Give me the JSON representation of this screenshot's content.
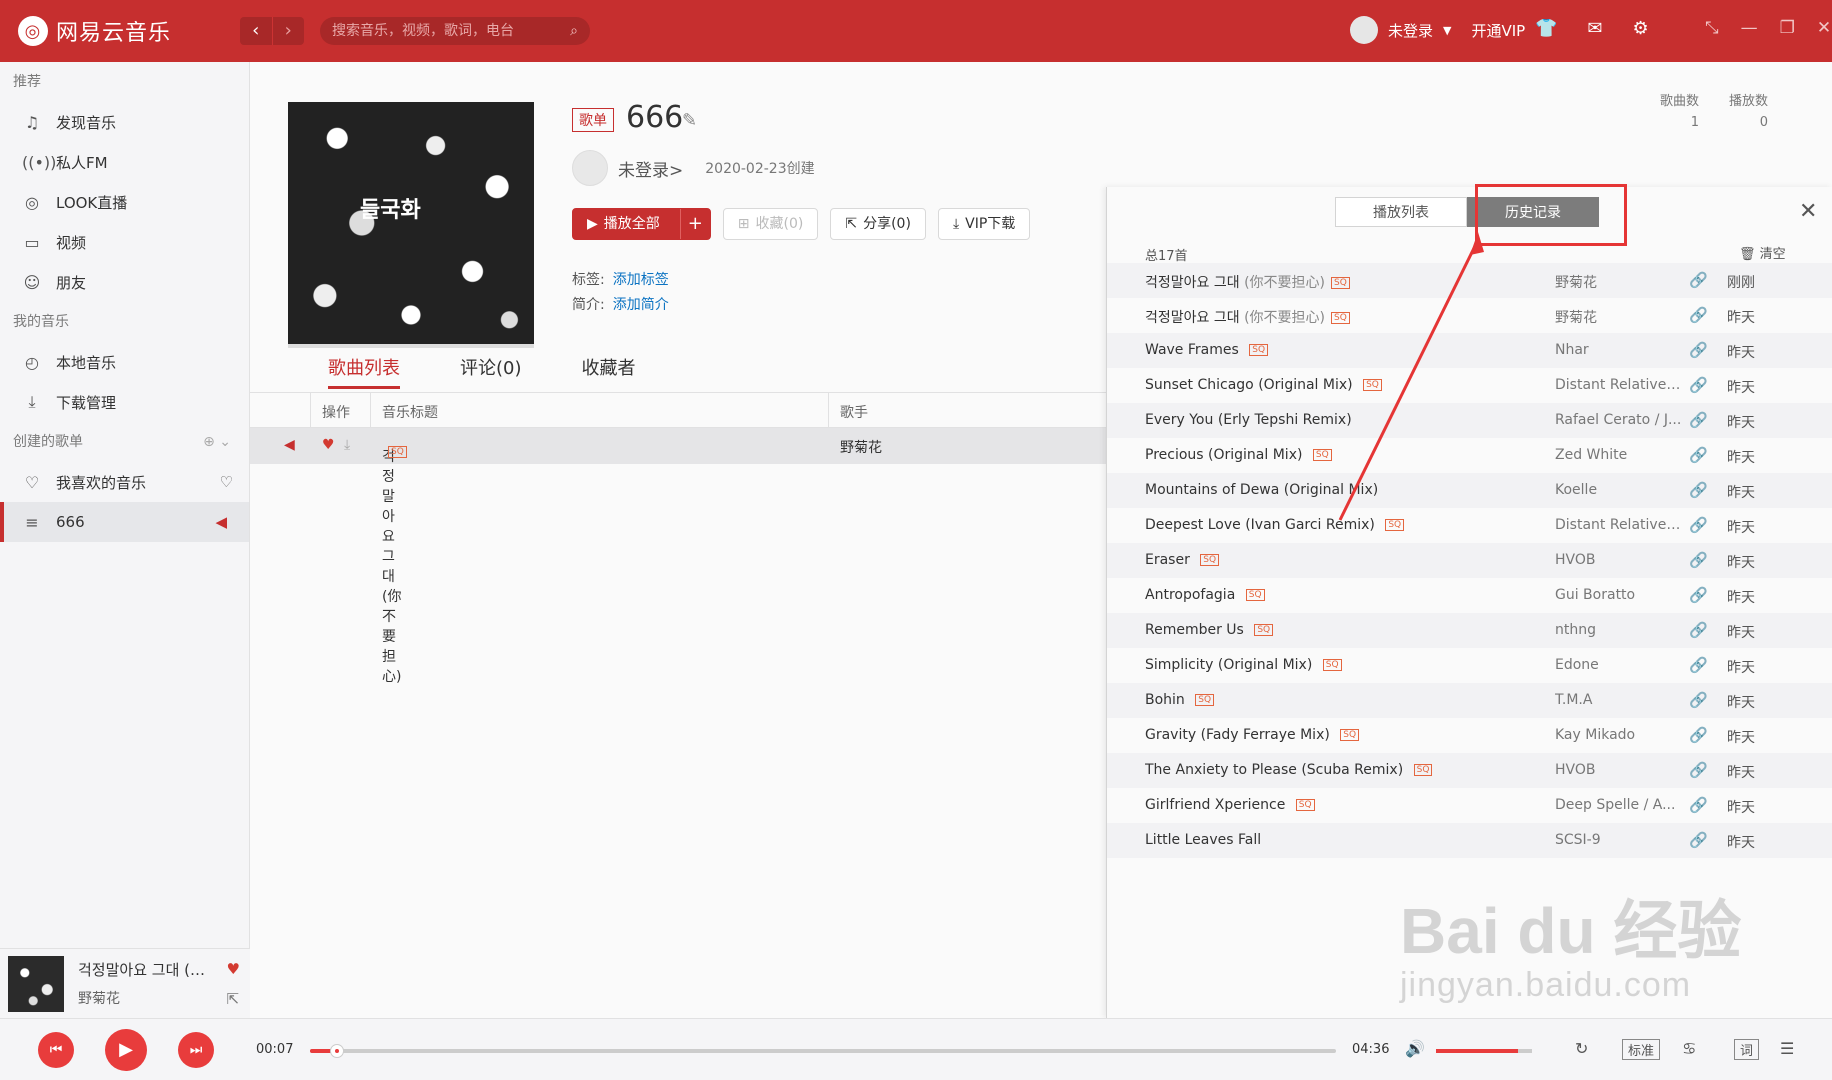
{
  "app": {
    "title": "网易云音乐",
    "logo_glyph": "◎"
  },
  "search": {
    "placeholder": "搜索音乐，视频，歌词，电台"
  },
  "user": {
    "name": "未登录",
    "vip": "开通VIP"
  },
  "sidebar": {
    "sec_recommend": "推荐",
    "recommend": [
      {
        "label": "发现音乐",
        "icon": "music-note-icon"
      },
      {
        "label": "私人FM",
        "icon": "radio-icon"
      },
      {
        "label": "LOOK直播",
        "icon": "live-icon"
      },
      {
        "label": "视频",
        "icon": "video-icon"
      },
      {
        "label": "朋友",
        "icon": "friends-icon"
      }
    ],
    "sec_mine": "我的音乐",
    "mine": [
      {
        "label": "本地音乐",
        "icon": "local-music-icon"
      },
      {
        "label": "下载管理",
        "icon": "download-icon"
      }
    ],
    "sec_created": "创建的歌单",
    "created": [
      {
        "label": "我喜欢的音乐",
        "icon": "heart-icon"
      },
      {
        "label": "666",
        "icon": "playlist-icon"
      }
    ]
  },
  "mini": {
    "title": "걱정말아요 그대 (…",
    "artist": "野菊花"
  },
  "playlist": {
    "badge": "歌单",
    "title": "666",
    "cover_text": "들국화",
    "creator": "未登录>",
    "created": "2020-02-23创建",
    "play_all": "播放全部",
    "collect": "收藏(0)",
    "share": "分享(0)",
    "vip_download": "VIP下载",
    "tags_label": "标签:",
    "tags_link": "添加标签",
    "intro_label": "简介:",
    "intro_link": "添加简介",
    "song_count_label": "歌曲数",
    "song_count": "1",
    "play_count_label": "播放数",
    "play_count": "0"
  },
  "tabs": [
    "歌曲列表",
    "评论(0)",
    "收藏者"
  ],
  "table": {
    "headers": {
      "ops": "操作",
      "title": "音乐标题",
      "artist": "歌手"
    },
    "row": {
      "title": "걱정말아요 그대 (你不要担心)",
      "artist": "野菊花",
      "quality": "SQ"
    }
  },
  "history_panel": {
    "tab_playlist": "播放列表",
    "tab_history": "历史记录",
    "total": "总17首",
    "clear": "清空",
    "tracks": [
      {
        "title": "걱정말아요 그대",
        "sub": "(你不要担心)",
        "sq": true,
        "artist": "野菊花",
        "time": "刚刚"
      },
      {
        "title": "걱정말아요 그대",
        "sub": "(你不要担心)",
        "sq": true,
        "artist": "野菊花",
        "time": "昨天"
      },
      {
        "title": "Wave Frames",
        "sub": "",
        "sq": true,
        "artist": "Nhar",
        "time": "昨天"
      },
      {
        "title": "Sunset Chicago (Original Mix)",
        "sub": "",
        "sq": true,
        "artist": "Distant Relatives...",
        "time": "昨天"
      },
      {
        "title": "Every You (Erly Tepshi Remix)",
        "sub": "",
        "sq": false,
        "artist": "Rafael Cerato / J...",
        "time": "昨天"
      },
      {
        "title": "Precious (Original Mix)",
        "sub": "",
        "sq": true,
        "artist": "Zed White",
        "time": "昨天"
      },
      {
        "title": "Mountains of Dewa (Original Mix)",
        "sub": "",
        "sq": false,
        "artist": "Koelle",
        "time": "昨天"
      },
      {
        "title": "Deepest Love (Ivan Garci Remix)",
        "sub": "",
        "sq": true,
        "artist": "Distant Relatives...",
        "time": "昨天"
      },
      {
        "title": "Eraser",
        "sub": "",
        "sq": true,
        "artist": "HVOB",
        "time": "昨天"
      },
      {
        "title": "Antropofagia",
        "sub": "",
        "sq": true,
        "artist": "Gui Boratto",
        "time": "昨天"
      },
      {
        "title": "Remember Us",
        "sub": "",
        "sq": true,
        "artist": "nthng",
        "time": "昨天"
      },
      {
        "title": "Simplicity (Original Mix)",
        "sub": "",
        "sq": true,
        "artist": "Edone",
        "time": "昨天"
      },
      {
        "title": "Bohin",
        "sub": "",
        "sq": true,
        "artist": "T.M.A",
        "time": "昨天"
      },
      {
        "title": "Gravity (Fady Ferraye Mix)",
        "sub": "",
        "sq": true,
        "artist": "Kay Mikado",
        "time": "昨天"
      },
      {
        "title": "The Anxiety to Please (Scuba Remix)",
        "sub": "",
        "sq": true,
        "artist": "HVOB",
        "time": "昨天"
      },
      {
        "title": "Girlfriend Xperience",
        "sub": "",
        "sq": true,
        "artist": "Deep Spelle / A...",
        "time": "昨天"
      },
      {
        "title": "Little Leaves Fall",
        "sub": "",
        "sq": false,
        "artist": "SCSI-9",
        "time": "昨天"
      }
    ]
  },
  "player": {
    "elapsed": "00:07",
    "duration": "04:36",
    "progress": 0.026,
    "volume": 0.85,
    "quality": "标准",
    "lyrics": "词"
  },
  "watermark": {
    "main": "Bai du 经验",
    "sub": "jingyan.baidu.com"
  },
  "colors": {
    "brand": "#c62f2f",
    "accent": "#e83c3c",
    "link": "#0c73c2",
    "annotation": "#e53535"
  }
}
